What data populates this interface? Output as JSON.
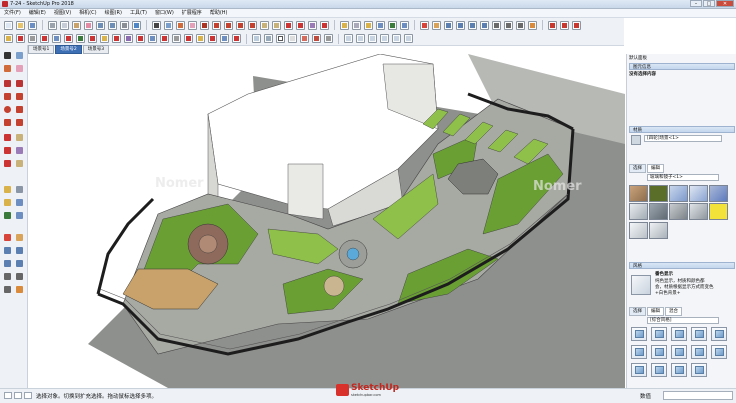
{
  "window": {
    "title": "7-24 - SketchUp Pro 2018",
    "min_glyph": "–",
    "max_glyph": "□",
    "close_glyph": "✕"
  },
  "menu": {
    "items": [
      "文件(F)",
      "编辑(E)",
      "视图(V)",
      "相机(C)",
      "绘图(R)",
      "工具(T)",
      "窗口(W)",
      "扩展程序",
      "帮助(H)"
    ]
  },
  "scenes": {
    "tabs": [
      "场景号1",
      "场景号2",
      "场景号3"
    ]
  },
  "panel": {
    "default_tray": "默认面板",
    "entity_info": "图元信息",
    "no_selection": "没有选择内容",
    "materials": "材质",
    "material_name": "[四轮]场景<1>",
    "tab_select": "选择",
    "tab_edit": "编辑",
    "combo_value": "玻璃和镜子<1>",
    "styles": "风格",
    "style_title": "番色显示",
    "style_desc_lines": [
      "纯色显示，材质和颜色都",
      "会，材质根据显示方式而变色",
      "+白色背景+"
    ],
    "tab_mix": "混合",
    "style_combo": "[综合风格]"
  },
  "status": {
    "message": "选择对象。切换到扩充选择。拖动鼠标选择多项。",
    "measure_label": "数值"
  },
  "watermarks": {
    "left": "Nomer",
    "right": "Nomer"
  },
  "logo": {
    "text": "SketchUp",
    "sub": "sketchupbar.com"
  },
  "colors": {
    "lawn": "#6a9f34",
    "lawn_light": "#8ec04a",
    "paving": "#a7a9a3",
    "paving_dark": "#7c7f7a",
    "building": "#ffffff",
    "site_gray": "#8d8f8c",
    "fence": "#1d1d1d",
    "deck": "#c8a26a",
    "water": "#5aa9d8",
    "brand_red": "#d8302b"
  }
}
